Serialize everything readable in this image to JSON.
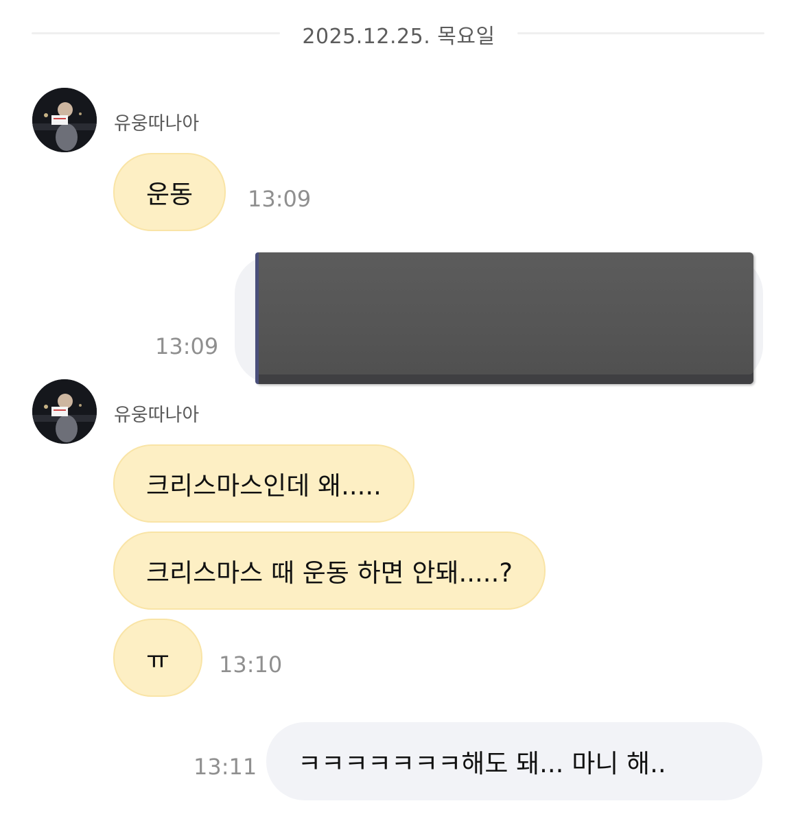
{
  "date_divider": "2025.12.25. 목요일",
  "groups": [
    {
      "sender": "유웅따나아",
      "messages": [
        {
          "text": "운동",
          "time": "13:09"
        }
      ]
    },
    {
      "sender": "유웅따나아",
      "messages": [
        {
          "text": "크리스마스인데 왜....."
        },
        {
          "text": "크리스마스 때 운동 하면 안돼.....?"
        },
        {
          "text": "ㅠ",
          "time": "13:10"
        }
      ]
    }
  ],
  "sent": [
    {
      "type": "image",
      "time": "13:09"
    },
    {
      "type": "text",
      "text": "ㅋㅋㅋㅋㅋㅋㅋ해도 돼... 마니 해..",
      "time": "13:11"
    }
  ],
  "colors": {
    "received_bubble": "#fdefc4",
    "sent_bubble": "#f2f3f7",
    "time_text": "#8f8f8f"
  }
}
